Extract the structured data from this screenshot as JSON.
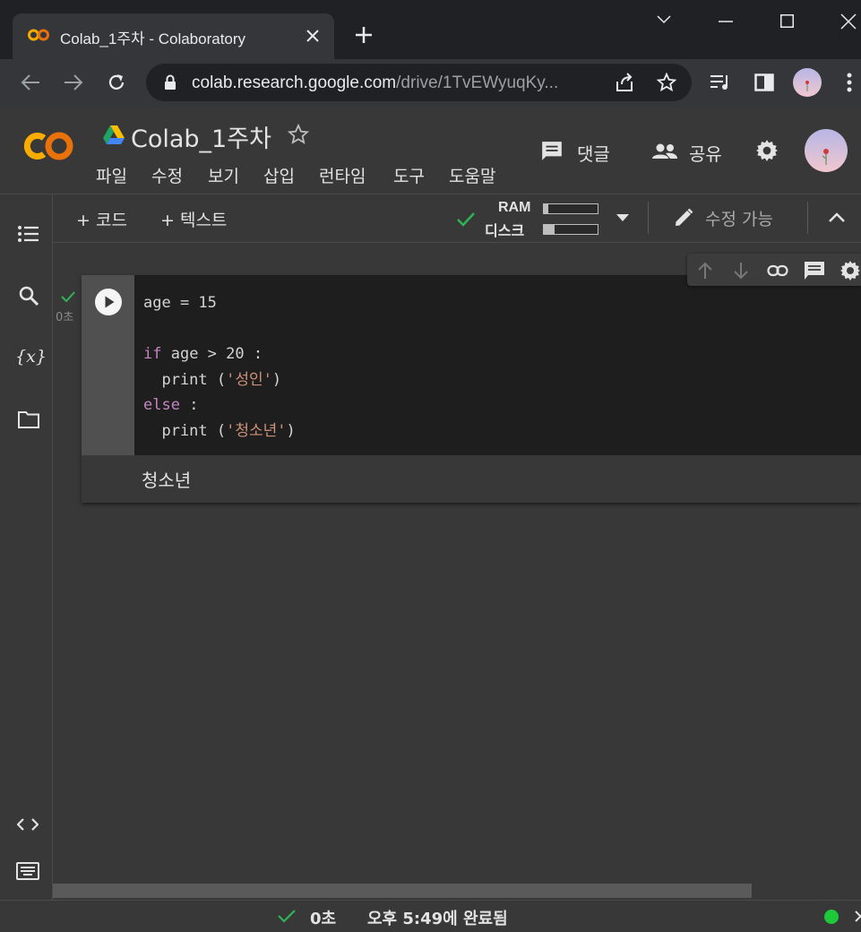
{
  "browser": {
    "tab_title": "Colab_1주차 - Colaboratory",
    "url_host": "colab.research.google.com",
    "url_path": "/drive/1TvEWyuqKy..."
  },
  "colab": {
    "doc_title": "Colab_1주차",
    "menu": [
      "파일",
      "수정",
      "보기",
      "삽입",
      "런타임",
      "도구",
      "도움말"
    ],
    "comment_label": "댓글",
    "share_label": "공유"
  },
  "toolbar": {
    "add_code": "+ 코드",
    "add_text": "+ 텍스트",
    "ram_label": "RAM",
    "disk_label": "디스크",
    "ram_fraction": 0.08,
    "disk_fraction": 0.2,
    "edit_label": "수정 가능"
  },
  "cell": {
    "exec_time": "0초",
    "code_lines": [
      "age = 15",
      "",
      "if age > 20 :",
      "  print ('성인')",
      "else :",
      "  print ('청소년')"
    ],
    "output": "청소년"
  },
  "status": {
    "elapsed": "0초",
    "completed": "오후 5:49에 완료됨"
  },
  "colors": {
    "keyword": "#c586c0",
    "string": "#ce9178",
    "check": "#2fb457",
    "status_dot": "#1ec93a"
  }
}
